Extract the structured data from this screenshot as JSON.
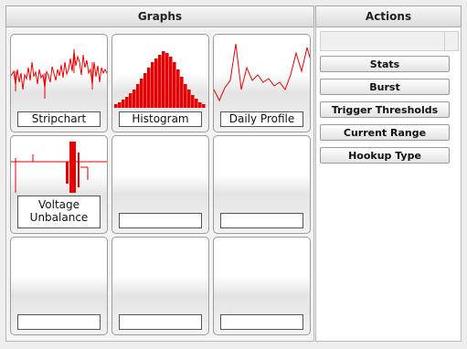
{
  "headers": {
    "graphs": "Graphs",
    "actions": "Actions"
  },
  "tiles": [
    {
      "label": "Stripchart",
      "icon": "stripchart-icon"
    },
    {
      "label": "Histogram",
      "icon": "histogram-icon"
    },
    {
      "label": "Daily Profile",
      "icon": "daily-profile-icon"
    },
    {
      "label": "Voltage Unbalance",
      "icon": "voltage-unbalance-icon"
    },
    {
      "label": ""
    },
    {
      "label": ""
    },
    {
      "label": ""
    },
    {
      "label": ""
    },
    {
      "label": ""
    }
  ],
  "actions": [
    {
      "label": "Stats"
    },
    {
      "label": "Burst"
    },
    {
      "label": "Trigger Thresholds"
    },
    {
      "label": "Current Range"
    },
    {
      "label": "Hookup Type"
    }
  ],
  "colors": {
    "graph": "#e60000"
  }
}
